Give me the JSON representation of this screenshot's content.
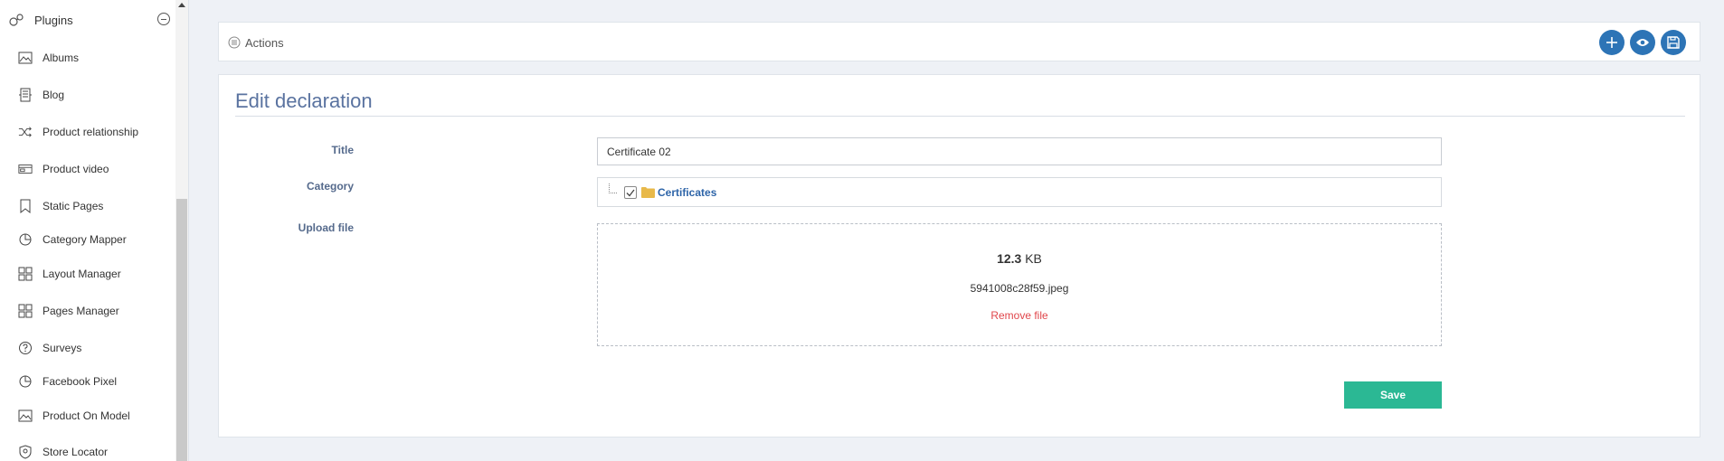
{
  "sidebar": {
    "header": {
      "label": "Plugins",
      "icon": "plugins-icon"
    },
    "items": [
      {
        "label": "Albums",
        "icon": "image-icon"
      },
      {
        "label": "Blog",
        "icon": "blog-icon"
      },
      {
        "label": "Product relationship",
        "icon": "shuffle-icon"
      },
      {
        "label": "Product video",
        "icon": "video-icon"
      },
      {
        "label": "Static Pages",
        "icon": "bookmark-icon"
      },
      {
        "label": "Category Mapper",
        "icon": "pie-chart-icon"
      },
      {
        "label": "Layout Manager",
        "icon": "layout-icon"
      },
      {
        "label": "Pages Manager",
        "icon": "layout-icon"
      },
      {
        "label": "Surveys",
        "icon": "question-icon"
      },
      {
        "label": "Facebook Pixel",
        "icon": "pie-chart-icon"
      },
      {
        "label": "Product On Model",
        "icon": "image-icon"
      },
      {
        "label": "Store Locator",
        "icon": "shield-icon"
      }
    ]
  },
  "actions": {
    "title": "Actions",
    "buttons": [
      {
        "name": "add-button",
        "icon": "plus-icon"
      },
      {
        "name": "preview-button",
        "icon": "eye-icon"
      },
      {
        "name": "save-icon-button",
        "icon": "floppy-icon"
      }
    ]
  },
  "form": {
    "heading": "Edit declaration",
    "title_label": "Title",
    "title_value": "Certificate 02",
    "category_label": "Category",
    "category_tree": {
      "label": "Certificates",
      "checked": true
    },
    "upload_label": "Upload file",
    "file": {
      "size_number": "12.3",
      "size_unit": "KB",
      "name": "5941008c28f59.jpeg",
      "remove_label": "Remove file"
    },
    "save_label": "Save"
  },
  "colors": {
    "accent": "#2d74b6",
    "save": "#2bb894",
    "danger": "#e0464b",
    "heading": "#5a73a0",
    "link": "#2d64a8"
  }
}
